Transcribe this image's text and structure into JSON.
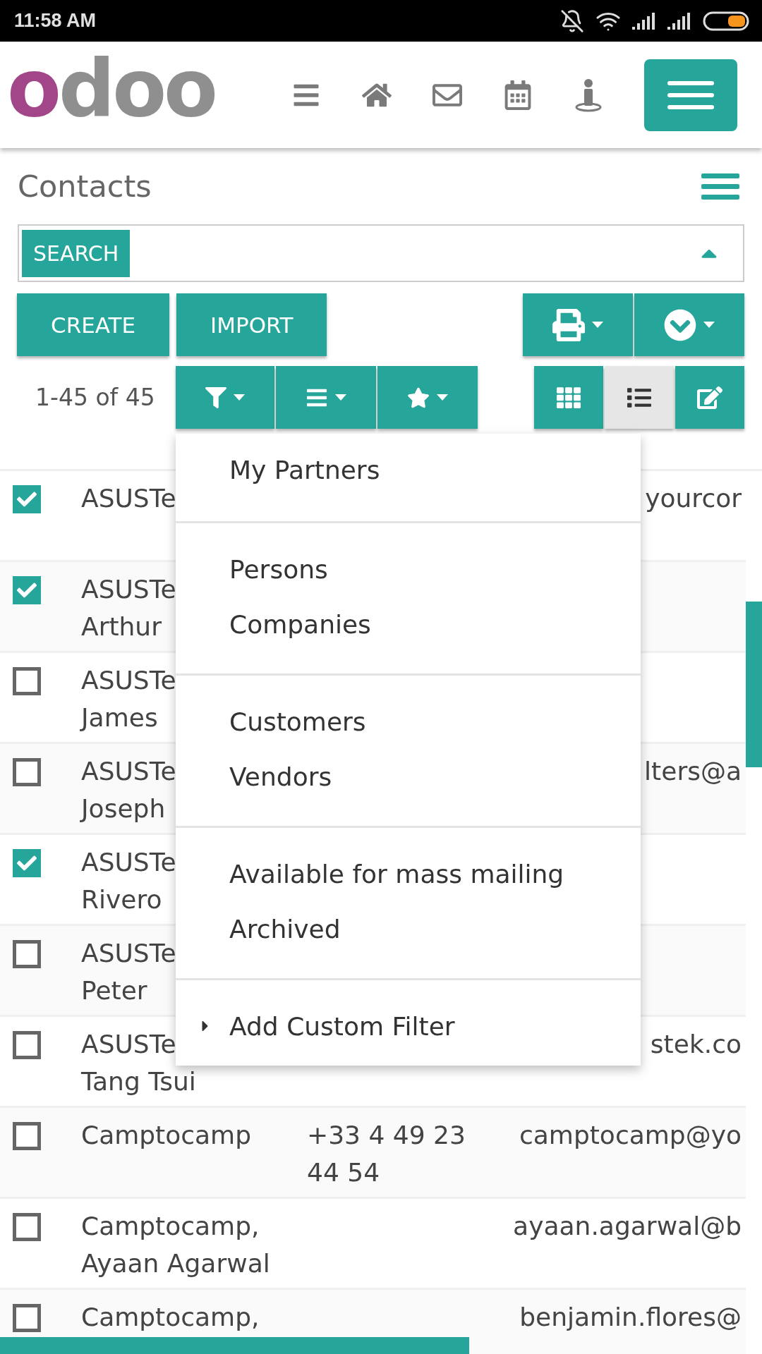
{
  "status_bar": {
    "time": "11:58 AM"
  },
  "header": {
    "logo": "odoo"
  },
  "page": {
    "title": "Contacts"
  },
  "search": {
    "facet": "SEARCH"
  },
  "actions": {
    "buttons": [
      "CREATE",
      "IMPORT"
    ]
  },
  "pager": "1-45 of 45",
  "views": [
    {
      "kind": "kanban",
      "selected": false
    },
    {
      "kind": "list",
      "selected": true
    },
    {
      "kind": "form",
      "selected": false
    }
  ],
  "filter_menu": {
    "open": true,
    "groups": [
      {
        "items": [
          {
            "kind": "option",
            "label": "My Partners"
          }
        ]
      },
      {
        "items": [
          {
            "kind": "option",
            "label": "Persons"
          },
          {
            "kind": "option",
            "label": "Companies"
          }
        ]
      },
      {
        "items": [
          {
            "kind": "option",
            "label": "Customers"
          },
          {
            "kind": "option",
            "label": "Vendors"
          }
        ]
      },
      {
        "items": [
          {
            "kind": "option",
            "label": "Available for mass mailing"
          },
          {
            "kind": "option",
            "label": "Archived"
          }
        ]
      },
      {
        "items": [
          {
            "kind": "submenu",
            "label": "Add Custom Filter"
          }
        ]
      }
    ]
  },
  "table": {
    "rows": [
      {
        "checked": true,
        "name_lines": [
          "ASUSTe"
        ],
        "email": "yourcor"
      },
      {
        "checked": true,
        "name_lines": [
          "ASUSTe",
          "Arthur"
        ]
      },
      {
        "checked": false,
        "name_lines": [
          "ASUSTe",
          "James"
        ]
      },
      {
        "checked": false,
        "name_lines": [
          "ASUSTe",
          "Joseph"
        ],
        "email": "lters@a"
      },
      {
        "checked": true,
        "name_lines": [
          "ASUSTe",
          "Rivero"
        ]
      },
      {
        "checked": false,
        "name_lines": [
          "ASUSTe",
          "Peter"
        ]
      },
      {
        "checked": false,
        "name_lines": [
          "ASUSTe",
          "Tang Tsui"
        ],
        "email": "stek.co"
      },
      {
        "checked": false,
        "name_lines": [
          "Camptocamp"
        ],
        "phone": "+33 4 49 23 44 54",
        "email": "camptocamp@yo"
      },
      {
        "checked": false,
        "name_lines": [
          "Camptocamp,",
          "Ayaan Agarwal"
        ],
        "email": "ayaan.agarwal@b"
      },
      {
        "checked": false,
        "name_lines": [
          "Camptocamp,"
        ],
        "email": "benjamin.flores@"
      }
    ]
  }
}
